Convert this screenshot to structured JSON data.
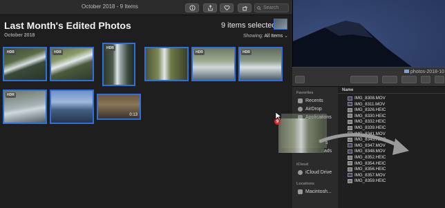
{
  "photos": {
    "window_title": "October 2018 - 9 Items",
    "heading": "Last Month's Edited Photos",
    "subheading": "October 2018",
    "selected_count": "9 items selected",
    "showing_label": "Showing:",
    "showing_value": "All Items",
    "search_placeholder": "Search",
    "toolbar_icons": [
      "info-icon",
      "share-icon",
      "heart-icon",
      "rotate-icon"
    ],
    "items": [
      {
        "badge": "HDR",
        "kind": "photo"
      },
      {
        "badge": "HDR",
        "kind": "photo"
      },
      {
        "badge": "HDR",
        "kind": "photo"
      },
      {
        "badge": "",
        "kind": "photo"
      },
      {
        "badge": "HDR",
        "kind": "photo"
      },
      {
        "badge": "HDR",
        "kind": "photo"
      },
      {
        "badge": "HDR",
        "kind": "photo"
      },
      {
        "badge": "",
        "kind": "photo"
      },
      {
        "badge": "",
        "kind": "video",
        "duration": "0:13"
      }
    ]
  },
  "finder": {
    "window_title": "photos-2018-10",
    "sidebar": {
      "favorites_label": "Favorites",
      "favorites": [
        "Recents",
        "AirDrop",
        "Applications"
      ],
      "partial_items": [
        "s",
        "oads"
      ],
      "icloud_label": "iCloud",
      "icloud_items": [
        "iCloud Drive"
      ],
      "locations_label": "Locations",
      "locations_items": [
        "Macintosh..."
      ]
    },
    "column_header": "Name",
    "files": [
      "IMG_8308.MOV",
      "IMG_8311.MOV",
      "IMG_8326.HEIC",
      "IMG_8330.HEIC",
      "IMG_8332.HEIC",
      "IMG_8339.HEIC",
      "IMG_8341.MOV",
      "IMG_8345.HEIC",
      "IMG_8347.MOV",
      "IMG_8348.MOV",
      "IMG_8352.HEIC",
      "IMG_8354.HEIC",
      "IMG_8356.HEIC",
      "IMG_8357.MOV",
      "IMG_8359.HEIC"
    ]
  },
  "drag": {
    "count_badge": "9"
  },
  "colors": {
    "selection": "#2f6fe0",
    "badge_red": "#e0252b"
  }
}
